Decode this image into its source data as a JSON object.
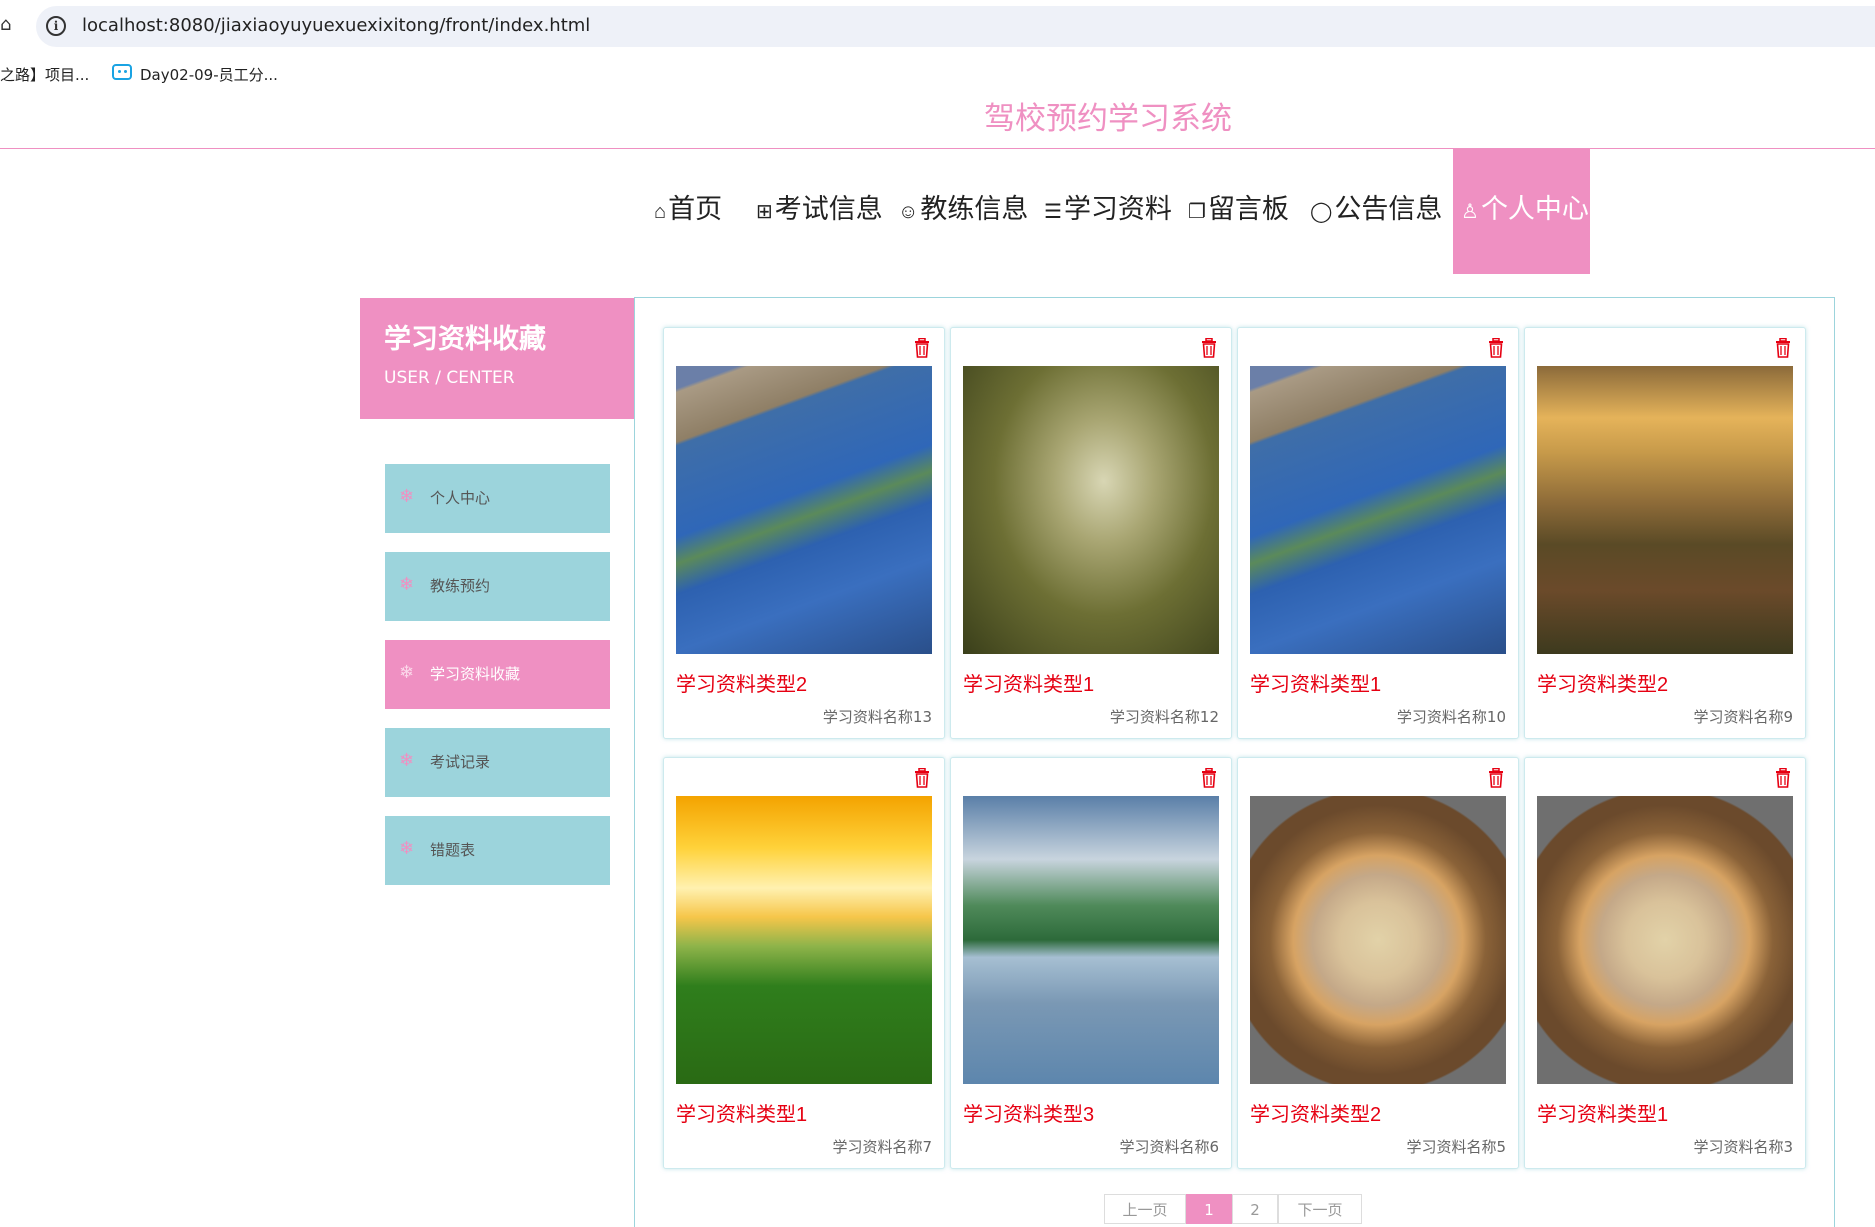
{
  "browser": {
    "url": "localhost:8080/jiaxiaoyuyuexuexixitong/front/index.html",
    "bookmarks": [
      "之路】项目...",
      "Day02-09-员工分..."
    ]
  },
  "site": {
    "title": "驾校预约学习系统"
  },
  "nav": {
    "items": [
      {
        "icon": "⌂",
        "label": "首页"
      },
      {
        "icon": "⊞",
        "label": "考试信息"
      },
      {
        "icon": "☺",
        "label": "教练信息"
      },
      {
        "icon": "☰",
        "label": "学习资料"
      },
      {
        "icon": "❐",
        "label": "留言板"
      },
      {
        "icon": "◯",
        "label": "公告信息"
      },
      {
        "icon": "♙",
        "label": "个人中心"
      }
    ],
    "active": "个人中心"
  },
  "sidebar": {
    "title": "学习资料收藏",
    "subtitle": "USER / CENTER",
    "items": [
      {
        "label": "个人中心"
      },
      {
        "label": "教练预约"
      },
      {
        "label": "学习资料收藏"
      },
      {
        "label": "考试记录"
      },
      {
        "label": "错题表"
      }
    ],
    "active": "学习资料收藏"
  },
  "cards": [
    {
      "type": "学习资料类型2",
      "name": "学习资料名称13",
      "image": "coast"
    },
    {
      "type": "学习资料类型1",
      "name": "学习资料名称12",
      "image": "forest-path"
    },
    {
      "type": "学习资料类型1",
      "name": "学习资料名称10",
      "image": "coast"
    },
    {
      "type": "学习资料类型2",
      "name": "学习资料名称9",
      "image": "mountain-valley"
    },
    {
      "type": "学习资料类型1",
      "name": "学习资料名称7",
      "image": "daisy-field"
    },
    {
      "type": "学习资料类型3",
      "name": "学习资料名称6",
      "image": "karst-lake"
    },
    {
      "type": "学习资料类型2",
      "name": "学习资料名称5",
      "image": "desert-sunset"
    },
    {
      "type": "学习资料类型1",
      "name": "学习资料名称3",
      "image": "desert-sunset"
    }
  ],
  "pagination": {
    "prev": "上一页",
    "pages": [
      "1",
      "2"
    ],
    "current": "1",
    "next": "下一页"
  },
  "colors": {
    "accent": "#ef90c2",
    "menu": "#9cd4dc",
    "type_text": "#e60012"
  }
}
